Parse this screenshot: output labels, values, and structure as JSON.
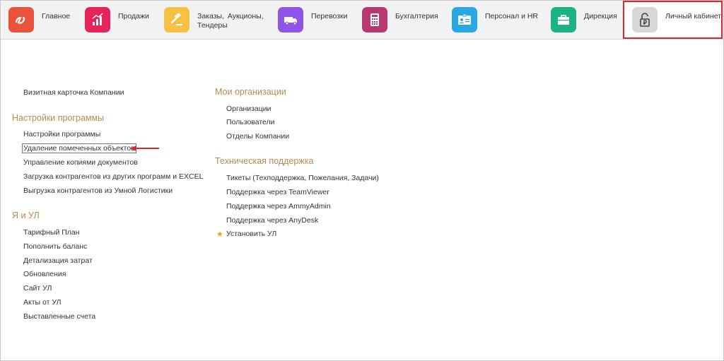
{
  "nav": {
    "items": [
      {
        "label": "Главное",
        "icon": "infinity-logo-icon",
        "color": "#e8533b"
      },
      {
        "label": "Продажи",
        "icon": "sales-chart-icon",
        "color": "#e5245c"
      },
      {
        "label": "Заказы, Аукционы, Тендеры",
        "line1": "Заказы, Аукционы,",
        "line2": "Тендеры",
        "icon": "gavel-icon",
        "color": "#f6c143"
      },
      {
        "label": "Перевозки",
        "icon": "truck-icon",
        "color": "#8f54e8"
      },
      {
        "label": "Бухгалтерия",
        "icon": "calculator-icon",
        "color": "#b9386f"
      },
      {
        "label": "Персонал и HR",
        "icon": "id-card-icon",
        "color": "#29a6e3"
      },
      {
        "label": "Дирекция",
        "icon": "briefcase-icon",
        "color": "#1bb386"
      },
      {
        "label": "Личный кабинет",
        "icon": "ruble-lock-icon",
        "color": "#d7d7d7"
      }
    ]
  },
  "left": {
    "company_card": "Визитная карточка Компании",
    "settings": {
      "title": "Настройки программы",
      "items": [
        "Настройки программы",
        "Удаление помеченных объектов",
        "Управление копиями документов",
        "Загрузка контрагентов из других программ и EXCEL",
        "Выгрузка контрагентов из Умной Логистики"
      ]
    },
    "me": {
      "title": "Я и УЛ",
      "items": [
        "Тарифный План",
        "Пополнить баланс",
        "Детализация затрат",
        "Обновления",
        "Сайт УЛ",
        "Акты от УЛ",
        "Выставленные счета"
      ]
    }
  },
  "right": {
    "orgs": {
      "title": "Мои организации",
      "items": [
        "Организации",
        "Пользователи",
        "Отделы Компании"
      ]
    },
    "support": {
      "title": "Техническая поддержка",
      "items": [
        "Тикеты (Техподдержка, Пожелания, Задачи)",
        "Поддержка через TeamViewer",
        "Поддержка через AmmyAdmin",
        "Поддержка через AnyDesk"
      ],
      "install": "Установить УЛ"
    }
  },
  "colors": {
    "section_title": "#b58a4e",
    "highlight": "#d9282f",
    "star": "#f0a020"
  }
}
